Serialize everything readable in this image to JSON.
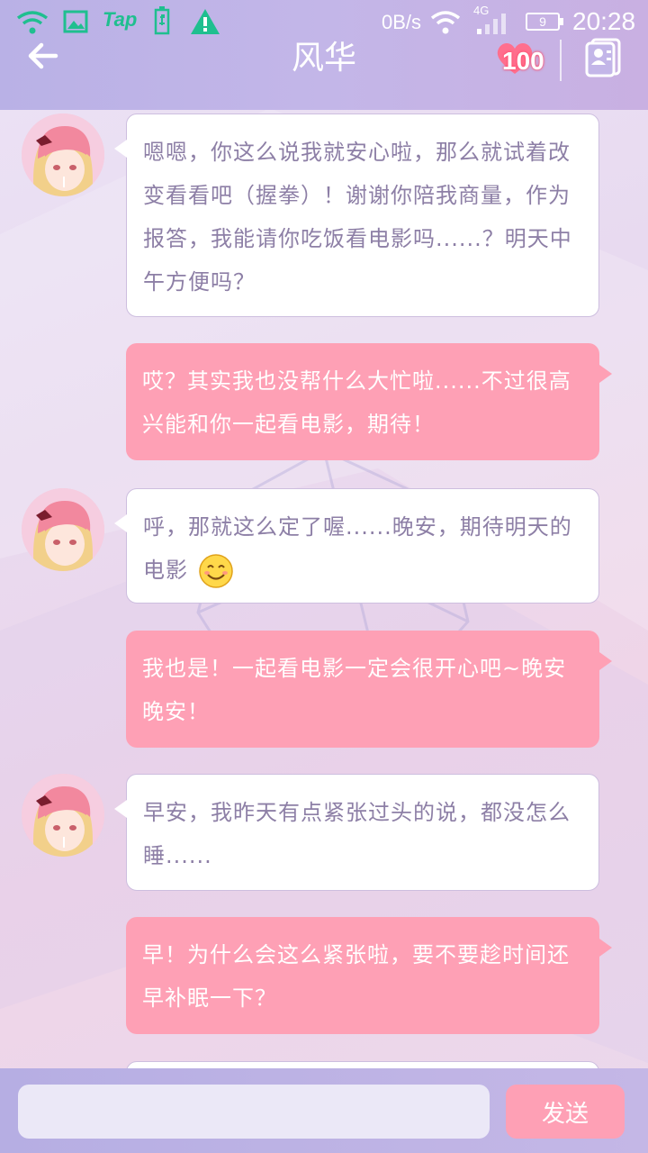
{
  "status_bar": {
    "network_speed": "0B/s",
    "network_type": "4G",
    "battery": "9",
    "time": "20:28",
    "tap_label": "Tap"
  },
  "header": {
    "title": "风华",
    "affection_value": "100",
    "back_icon": "arrow-left-icon",
    "contact_icon": "contact-card-icon"
  },
  "messages": [
    {
      "sender": "her",
      "text": "嗯嗯，你这么说我就安心啦，那么就试着改变看看吧（握拳）！谢谢你陪我商量，作为报答，我能请你吃饭看电影吗......？明天中午方便吗？"
    },
    {
      "sender": "me",
      "text": "哎？其实我也没帮什么大忙啦......不过很高兴能和你一起看电影，期待！"
    },
    {
      "sender": "her",
      "text": "呼，那就这么定了喔......晚安，期待明天的电影",
      "emoji": "smile-emoji-icon"
    },
    {
      "sender": "me",
      "text": "我也是！一起看电影一定会很开心吧~晚安晚安！"
    },
    {
      "sender": "her",
      "text": "早安，我昨天有点紧张过头的说，都没怎么睡......"
    },
    {
      "sender": "me",
      "text": "早！为什么会这么紧张啦，要不要趁时间还早补眠一下？"
    }
  ],
  "input_bar": {
    "placeholder": "",
    "send_label": "发送"
  },
  "colors": {
    "header": "#c0b4e7",
    "bubble_in": "#ffffff",
    "bubble_in_text": "#8d7fa6",
    "bubble_out": "#fea0b5",
    "bubble_out_text": "#ffffff",
    "status_green": "#1fbf8f"
  }
}
